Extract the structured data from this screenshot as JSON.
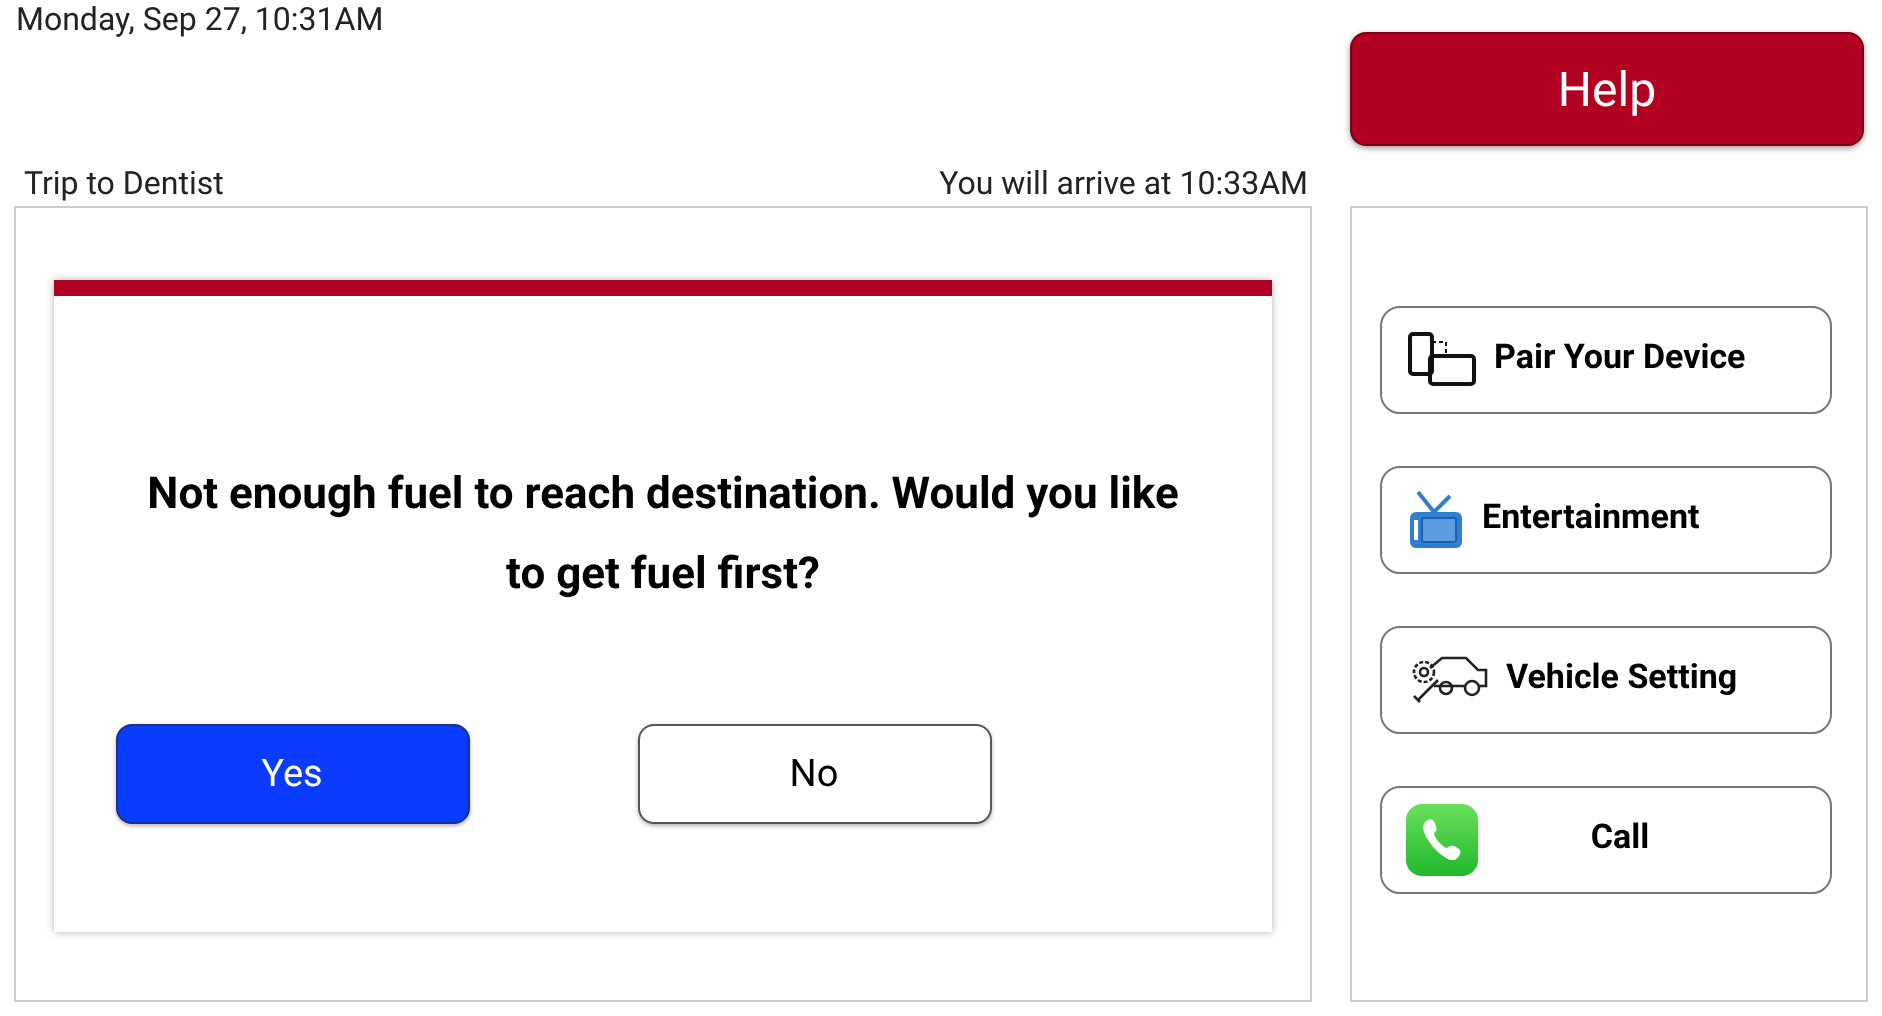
{
  "datetime": "Monday, Sep 27, 10:31AM",
  "help_button": "Help",
  "trip": {
    "title": "Trip to Dentist",
    "arrival": "You will arrive at 10:33AM"
  },
  "dialog": {
    "message": "Not enough fuel to reach destination. Would you like to get fuel first?",
    "buttons": [
      {
        "label": "Yes",
        "kind": "primary"
      },
      {
        "label": "No",
        "kind": "secondary"
      }
    ]
  },
  "menu": [
    {
      "label": "Pair Your Device",
      "kind": "devices"
    },
    {
      "label": "Entertainment",
      "kind": "tv"
    },
    {
      "label": "Vehicle Setting",
      "kind": "vehicle"
    },
    {
      "label": "Call",
      "kind": "phone"
    }
  ]
}
